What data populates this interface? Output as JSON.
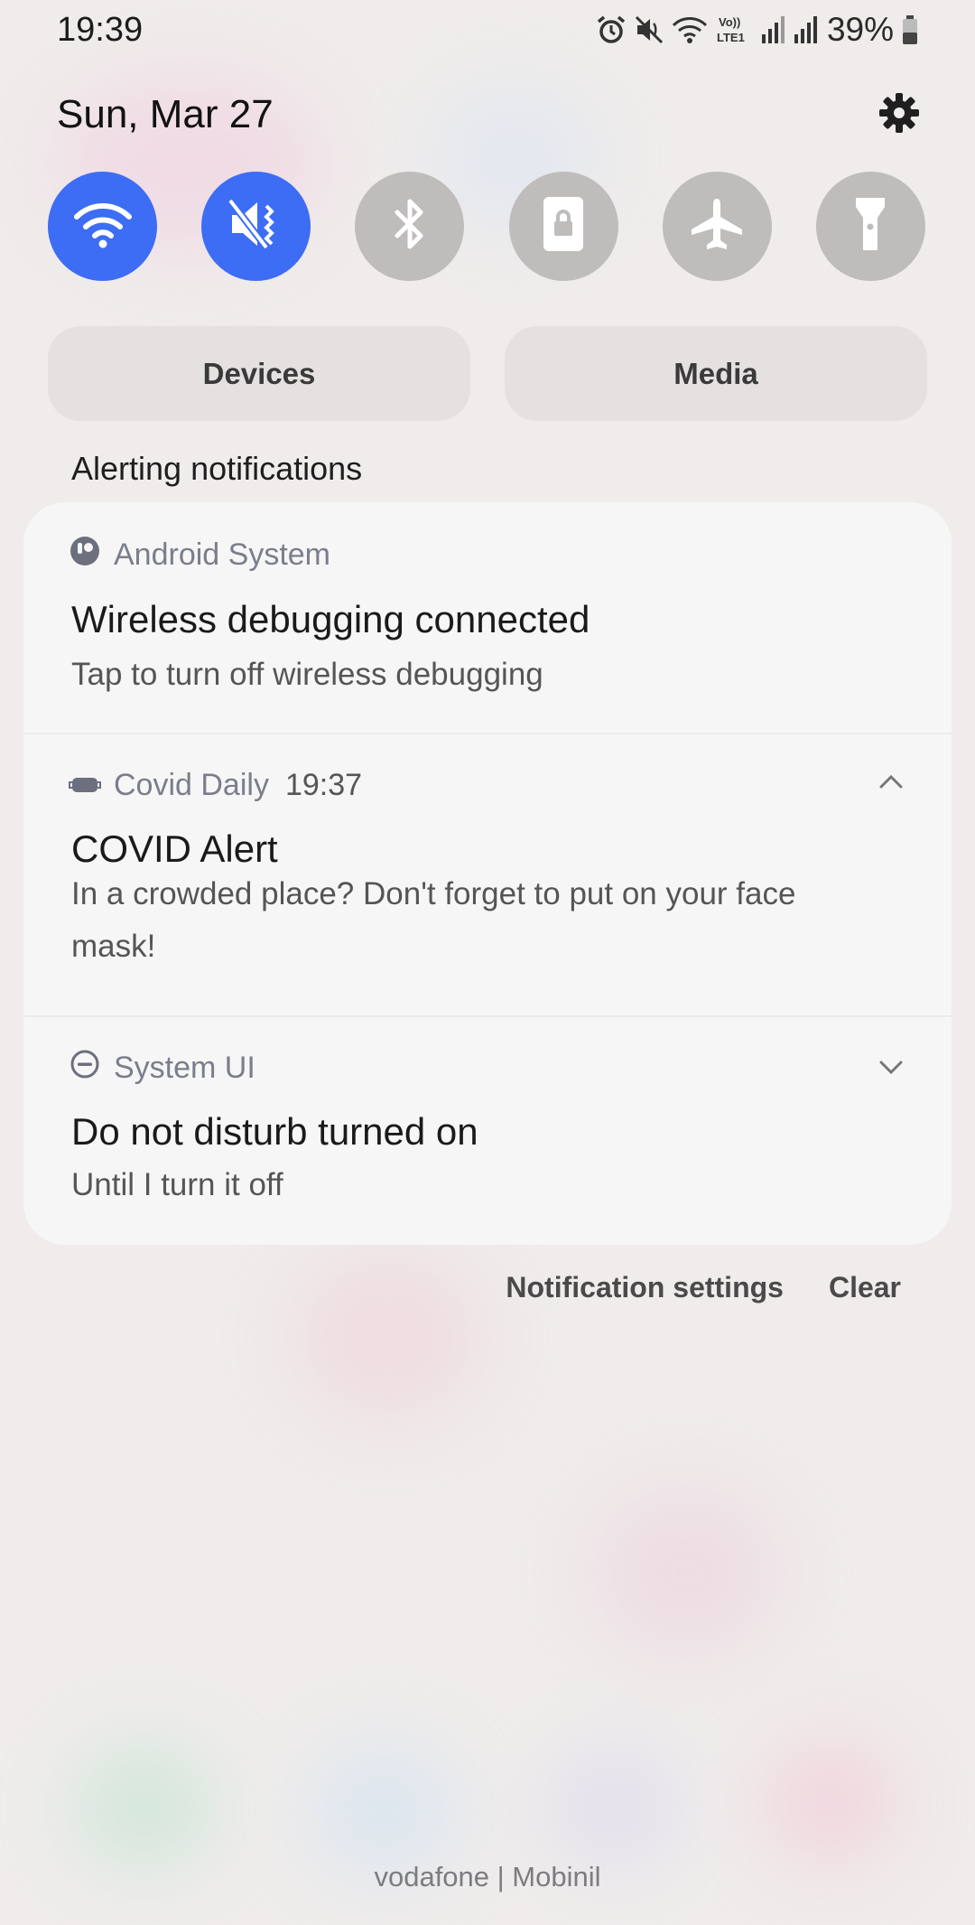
{
  "status_bar": {
    "time": "19:39",
    "battery_percent": "39%",
    "icons": [
      "alarm-icon",
      "mute-icon",
      "wifi-calling-icon",
      "volte-lte1-icon",
      "signal-sim1-icon",
      "signal-sim2-icon",
      "battery-icon"
    ]
  },
  "header": {
    "date": "Sun, Mar 27",
    "settings_icon": "gear-icon"
  },
  "quick_tiles": [
    {
      "name": "wifi",
      "icon": "wifi-icon",
      "active": true
    },
    {
      "name": "sound",
      "icon": "mute-vibrate-icon",
      "active": true
    },
    {
      "name": "bluetooth",
      "icon": "bluetooth-icon",
      "active": false
    },
    {
      "name": "rotation-lock",
      "icon": "portrait-lock-icon",
      "active": false
    },
    {
      "name": "airplane",
      "icon": "airplane-icon",
      "active": false
    },
    {
      "name": "flashlight",
      "icon": "flashlight-icon",
      "active": false
    }
  ],
  "segments": {
    "devices_label": "Devices",
    "media_label": "Media"
  },
  "section_label": "Alerting notifications",
  "notifications": [
    {
      "app": "Android System",
      "icon": "android-system-icon",
      "time": "",
      "title": "Wireless debugging connected",
      "body": "Tap to turn off wireless debugging"
    },
    {
      "app": "Covid Daily",
      "icon": "mask-icon",
      "time": "19:37",
      "title": "COVID Alert",
      "body": "In a crowded place? Don't forget to put on your face mask!",
      "expand_state": "chevron-up-icon"
    },
    {
      "app": "System UI",
      "icon": "do-not-disturb-icon",
      "time": "",
      "title": "Do not disturb turned on",
      "body": "Until I turn it off",
      "expand_state": "chevron-down-icon"
    }
  ],
  "footer": {
    "notification_settings_label": "Notification settings",
    "clear_label": "Clear"
  },
  "carrier_text": "vodafone | Mobinil",
  "colors": {
    "accent_tile": "#3d6df5",
    "inactive_tile": "#bfbcbc",
    "background": "#efeceb",
    "panel": "#f7f6f6"
  }
}
